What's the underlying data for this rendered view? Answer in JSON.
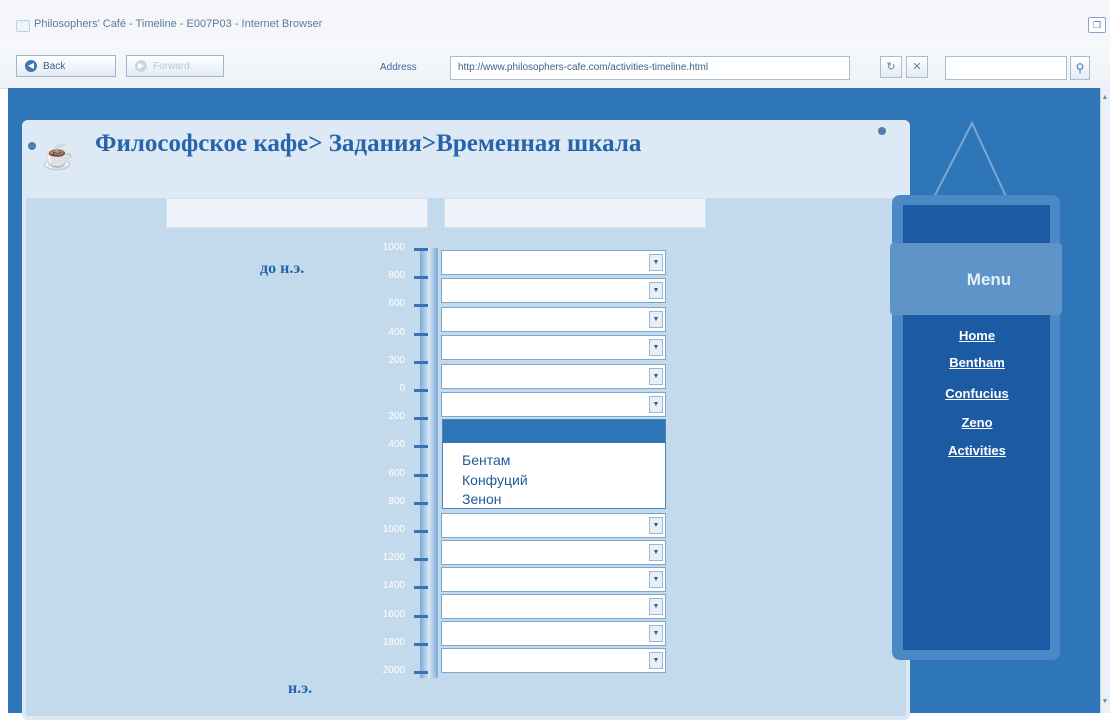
{
  "browser": {
    "window_title": "Philosophers' Café - Timeline - E007P03 - Internet Browser",
    "back_label": "Back",
    "forward_label": "Forward",
    "address_label": "Address",
    "url": "http://www.philosophers-cafe.com/activities-timeline.html"
  },
  "page": {
    "title": "Философское кафе> Задания>Временная шкала",
    "era_bc": "до н.э.",
    "era_ad": "н.э."
  },
  "timeline": {
    "ticks": [
      "1000",
      "800",
      "600",
      "400",
      "200",
      "0",
      "200",
      "400",
      "600",
      "800",
      "1000",
      "1200",
      "1400",
      "1600",
      "1800",
      "2000"
    ]
  },
  "dropdown": {
    "options": [
      "Бентам",
      "Конфуций",
      "Зенон"
    ]
  },
  "menu": {
    "title": "Menu",
    "items": [
      "Home",
      "Bentham",
      "Confucius",
      "Zeno",
      "Activities"
    ]
  },
  "colors": {
    "accent": "#2f76b8",
    "menu_dark": "#1c5ba3",
    "title_text": "#2764ab"
  }
}
